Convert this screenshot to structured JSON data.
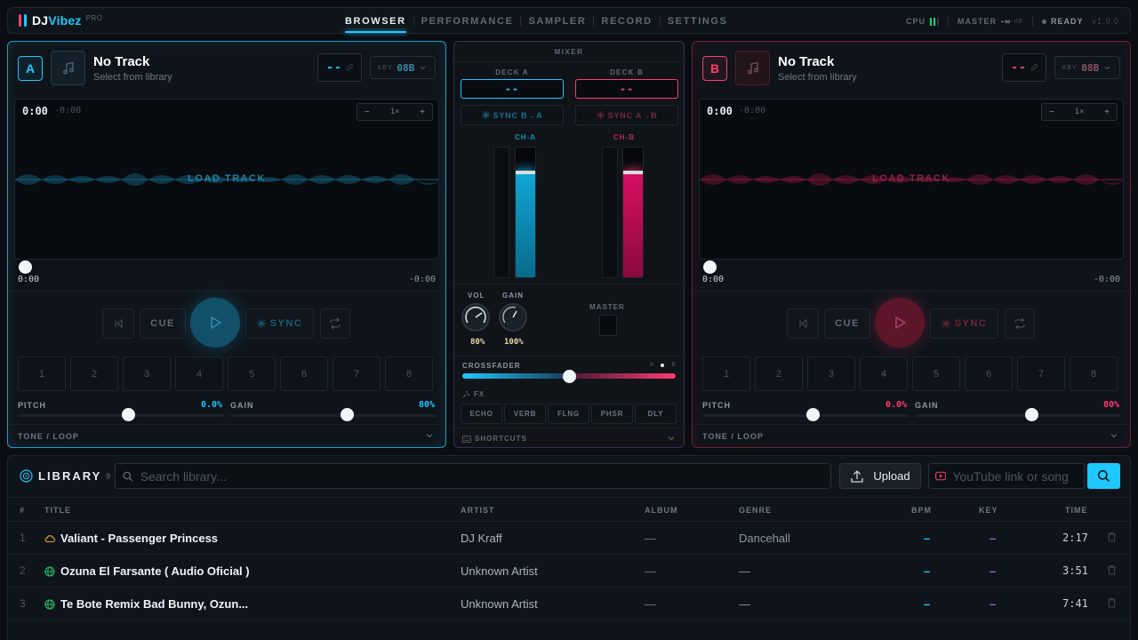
{
  "app": {
    "logo_dj": "DJ",
    "logo_vibez": "Vibez",
    "edition": "PRO",
    "version": "v1.0.0"
  },
  "nav": {
    "items": [
      {
        "label": "BROWSER",
        "active": true
      },
      {
        "label": "PERFORMANCE",
        "active": false
      },
      {
        "label": "SAMPLER",
        "active": false
      },
      {
        "label": "RECORD",
        "active": false
      },
      {
        "label": "SETTINGS",
        "active": false
      }
    ]
  },
  "status": {
    "cpu_label": "CPU",
    "master_label": "MASTER",
    "master_value": "-∞",
    "master_unit": "dB",
    "ready_label": "READY"
  },
  "decks": {
    "a": {
      "badge": "A",
      "title": "No Track",
      "subtitle": "Select from library",
      "bpm": "--",
      "key_label": "KEY",
      "key": "08B",
      "time": "0:00",
      "remaining": "-0:00",
      "zoom": "1×",
      "zoom_minus": "−",
      "zoom_plus": "+",
      "load_label": "LOAD TRACK",
      "position": "0:00",
      "position_remaining": "-0:00",
      "cue_label": "CUE",
      "sync_label": "SYNC",
      "pads": [
        "1",
        "2",
        "3",
        "4",
        "5",
        "6",
        "7",
        "8"
      ],
      "pitch_label": "PITCH",
      "pitch_value": "0.0%",
      "gain_label": "GAIN",
      "gain_value": "80%",
      "tone_label": "TONE / LOOP",
      "accent": "#1fc8ff"
    },
    "b": {
      "badge": "B",
      "title": "No Track",
      "subtitle": "Select from library",
      "bpm": "--",
      "key_label": "KEY",
      "key": "08B",
      "time": "0:00",
      "remaining": "-0:00",
      "zoom": "1×",
      "zoom_minus": "−",
      "zoom_plus": "+",
      "load_label": "LOAD TRACK",
      "position": "0:00",
      "position_remaining": "-0:00",
      "cue_label": "CUE",
      "sync_label": "SYNC",
      "pads": [
        "1",
        "2",
        "3",
        "4",
        "5",
        "6",
        "7",
        "8"
      ],
      "pitch_label": "PITCH",
      "pitch_value": "0.0%",
      "gain_label": "GAIN",
      "gain_value": "80%",
      "tone_label": "TONE / LOOP",
      "accent": "#ff3d6e"
    }
  },
  "mixer": {
    "title": "MIXER",
    "deck_a_label": "DECK A",
    "deck_b_label": "DECK B",
    "deck_a_bpm": "--",
    "deck_b_bpm": "--",
    "sync_b_to_a": "SYNC B→A",
    "sync_a_to_b": "SYNC A→B",
    "ch_a": "CH-A",
    "ch_b": "CH-B",
    "ch_a_level": 0.82,
    "ch_b_level": 0.82,
    "vol_label": "VOL",
    "vol_value": "80%",
    "gain_label": "GAIN",
    "gain_value": "100%",
    "master_label": "MASTER",
    "crossfader_label": "CROSSFADER",
    "crossfader_a": "A",
    "crossfader_b": "B",
    "crossfader_position": 0.5,
    "fx_label": "FX",
    "fx": [
      "ECHO",
      "VERB",
      "FLNG",
      "PHSR",
      "DLY"
    ],
    "shortcuts_label": "SHORTCUTS"
  },
  "library": {
    "title": "LIBRARY",
    "count": "9",
    "search_placeholder": "Search library...",
    "upload_label": "Upload",
    "youtube_placeholder": "YouTube link or song",
    "columns": [
      "#",
      "TITLE",
      "ARTIST",
      "ALBUM",
      "GENRE",
      "BPM",
      "KEY",
      "TIME"
    ],
    "rows": [
      {
        "num": "1",
        "title": "Valiant - Passenger Princess",
        "artist": "DJ Kraff",
        "album": "—",
        "genre": "Dancehall",
        "bpm": "–",
        "key": "–",
        "time": "2:17",
        "source_icon": "cloud-icon"
      },
      {
        "num": "2",
        "title": "Ozuna El Farsante ( Audio Oficial )",
        "artist": "Unknown Artist",
        "album": "—",
        "genre": "—",
        "bpm": "–",
        "key": "–",
        "time": "3:51",
        "source_icon": "globe-icon"
      },
      {
        "num": "3",
        "title": "Te Bote Remix Bad Bunny, Ozun...",
        "artist": "Unknown Artist",
        "album": "—",
        "genre": "—",
        "bpm": "–",
        "key": "–",
        "time": "7:41",
        "source_icon": "globe-icon"
      }
    ]
  },
  "colors": {
    "deck_a": "#1fc8ff",
    "deck_b": "#ff3d6e",
    "key_purple": "#9b6bd8",
    "ready_green": "#27d17f"
  }
}
